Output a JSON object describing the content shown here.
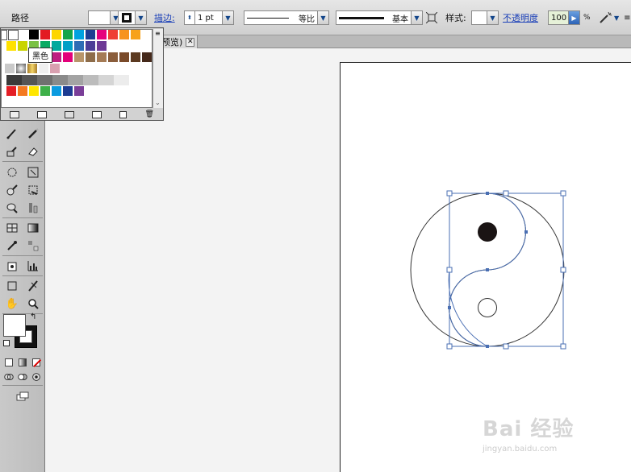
{
  "controlbar": {
    "object_type": "路径",
    "stroke_label": "描边:",
    "stroke_weight": "1 pt",
    "profile_label": "等比",
    "brush_label": "基本",
    "style_label": "样式:",
    "opacity_label": "不透明度",
    "opacity_value": "100",
    "opacity_unit": "%"
  },
  "tabbar": {
    "doc_tab_label": "预览)",
    "close_glyph": "✕"
  },
  "swatches": {
    "tooltip": "黑色",
    "colors_row1": [
      "#ffffff",
      "#000000",
      "#e31b23",
      "#fdd600",
      "#12a54a",
      "#00a2e0",
      "#1f3d92",
      "#e6007e",
      "#ef3f35",
      "#f7931e",
      "#f7a21b"
    ],
    "colors_row2": [
      "#ffe100",
      "#c9d400",
      "#7ac143",
      "#0aab64",
      "#00a99d",
      "#00a0c6",
      "#2d6db5",
      "#4b3d97",
      "#6e3996"
    ],
    "colors_row3": [
      "#bf1e80",
      "#e3007a",
      "#b8956a",
      "#8e6d4a",
      "#a57b55",
      "#8a5d3b",
      "#7a4a2a",
      "#5c3a21",
      "#45291a"
    ],
    "colors_row6": [
      "#e41e25",
      "#f47920",
      "#ffe600",
      "#3eb049",
      "#0b9be0",
      "#1d3c92",
      "#7a3e98"
    ],
    "grey_bar": [
      "#3a3a3a",
      "#555555",
      "#707070",
      "#8a8a8a",
      "#a3a3a3",
      "#bcbcbc",
      "#d5d5d5",
      "#ececec"
    ]
  },
  "watermark": {
    "brand": "Bai 经验",
    "url": "jingyan.baidu.com"
  }
}
